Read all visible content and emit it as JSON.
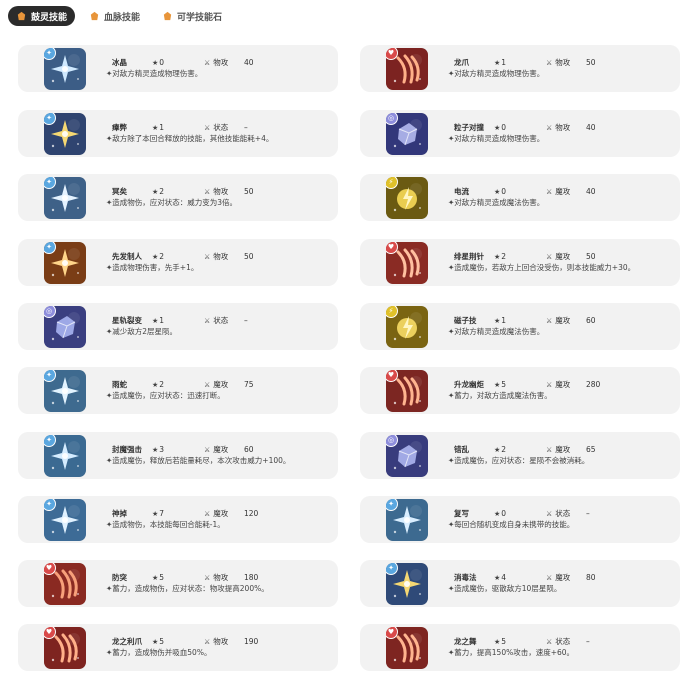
{
  "tabs": [
    {
      "label": "鼓灵技能",
      "active": true,
      "icon": "spirit-icon",
      "color": "#e8953a"
    },
    {
      "label": "血脉技能",
      "active": false,
      "icon": "bloodline-icon",
      "color": "#e8953a"
    },
    {
      "label": "可学技能石",
      "active": false,
      "icon": "skill-stone-icon",
      "color": "#e8953a"
    }
  ],
  "skills_left": [
    {
      "name": "冰晶",
      "cost": "0",
      "category": "物攻",
      "power": "40",
      "desc": "✦对敌方精灵造成物理伤害。",
      "element": "ice",
      "badge_color": "#5aa7e0",
      "art_bg": "#3c5d86",
      "art_fg": "#cfe9ff"
    },
    {
      "name": "瘴弊",
      "cost": "1",
      "category": "状态",
      "power": "–",
      "desc": "✦敌方除了本回合释放的技能，其他技能能耗+4。",
      "element": "ice",
      "badge_color": "#5aa7e0",
      "art_bg": "#2f4470",
      "art_fg": "#f5d873"
    },
    {
      "name": "冥矣",
      "cost": "2",
      "category": "物攻",
      "power": "50",
      "desc": "✦造成物伤，应对状态：威力变为3倍。",
      "element": "ice",
      "badge_color": "#5aa7e0",
      "art_bg": "#3e6188",
      "art_fg": "#e4f2ff"
    },
    {
      "name": "先发制人",
      "cost": "2",
      "category": "物攻",
      "power": "50",
      "desc": "✦造成物理伤害，先手+1。",
      "element": "ice",
      "badge_color": "#5aa7e0",
      "art_bg": "#7a3d16",
      "art_fg": "#ffd58a"
    },
    {
      "name": "星轨裂变",
      "cost": "1",
      "category": "状态",
      "power": "–",
      "desc": "✦减少敌方2层星陨。",
      "element": "spiral",
      "badge_color": "#8e8edc",
      "art_bg": "#3a3f80",
      "art_fg": "#b7c3ff"
    },
    {
      "name": "雨蛇",
      "cost": "2",
      "category": "魔攻",
      "power": "75",
      "desc": "✦造成魔伤，应对状态：迅速打断。",
      "element": "ice",
      "badge_color": "#5aa7e0",
      "art_bg": "#3e6a8f",
      "art_fg": "#e2f3ff"
    },
    {
      "name": "封魔强击",
      "cost": "3",
      "category": "魔攻",
      "power": "60",
      "desc": "✦造成魔伤，释放后若能量耗尽，本次攻击威力+100。",
      "element": "ice",
      "badge_color": "#5aa7e0",
      "art_bg": "#3b6a92",
      "art_fg": "#d4ecff"
    },
    {
      "name": "神掉",
      "cost": "7",
      "category": "魔攻",
      "power": "120",
      "desc": "✦造成物伤，本技能每回合能耗-1。",
      "element": "ice",
      "badge_color": "#5aa7e0",
      "art_bg": "#3d6b96",
      "art_fg": "#dff1ff"
    },
    {
      "name": "防突",
      "cost": "5",
      "category": "物攻",
      "power": "180",
      "desc": "✦蓄力，造成物伤，应对状态：物攻提高200%。",
      "element": "dragon",
      "badge_color": "#d94a4a",
      "art_bg": "#8a2a22",
      "art_fg": "#f7a07a"
    },
    {
      "name": "龙之利爪",
      "cost": "5",
      "category": "物攻",
      "power": "190",
      "desc": "✦蓄力，造成物伤并吸血50%。",
      "element": "dragon",
      "badge_color": "#d94a4a",
      "art_bg": "#7e2420",
      "art_fg": "#ffb089"
    }
  ],
  "skills_right": [
    {
      "name": "龙爪",
      "cost": "1",
      "category": "物攻",
      "power": "50",
      "desc": "✦对敌方精灵造成物理伤害。",
      "element": "dragon",
      "badge_color": "#d94a4a",
      "art_bg": "#7c2321",
      "art_fg": "#ffb089"
    },
    {
      "name": "粒子对撞",
      "cost": "0",
      "category": "物攻",
      "power": "40",
      "desc": "✦对敌方精灵造成物理伤害。",
      "element": "spiral",
      "badge_color": "#8e8edc",
      "art_bg": "#32377a",
      "art_fg": "#c3c9ff"
    },
    {
      "name": "电流",
      "cost": "0",
      "category": "魔攻",
      "power": "40",
      "desc": "✦对敌方精灵造成魔法伤害。",
      "element": "electric",
      "badge_color": "#e0c12a",
      "art_bg": "#6b5a12",
      "art_fg": "#ffe25c"
    },
    {
      "name": "绯星荆针",
      "cost": "2",
      "category": "魔攻",
      "power": "50",
      "desc": "✦造成魔伤，若敌方上回合没受伤，则本技能威力+30。",
      "element": "dragon",
      "badge_color": "#d94a4a",
      "art_bg": "#8a2b24",
      "art_fg": "#ffc0a0"
    },
    {
      "name": "磁子技",
      "cost": "1",
      "category": "魔攻",
      "power": "60",
      "desc": "✦对敌方精灵造成魔法伤害。",
      "element": "electric",
      "badge_color": "#e0c12a",
      "art_bg": "#7a6412",
      "art_fg": "#ffe36b"
    },
    {
      "name": "升龙幽炬",
      "cost": "5",
      "category": "魔攻",
      "power": "280",
      "desc": "✦蓄力，对敌方造成魔法伤害。",
      "element": "dragon",
      "badge_color": "#d94a4a",
      "art_bg": "#7c2622",
      "art_fg": "#ffb48f"
    },
    {
      "name": "错乱",
      "cost": "2",
      "category": "魔攻",
      "power": "65",
      "desc": "✦造成魔伤，应对状态：星陨不会被消耗。",
      "element": "spiral",
      "badge_color": "#8e8edc",
      "art_bg": "#383c7d",
      "art_fg": "#bcc4ff"
    },
    {
      "name": "复写",
      "cost": "0",
      "category": "状态",
      "power": "–",
      "desc": "✦每回合随机变成自身未携带的技能。",
      "element": "ice",
      "badge_color": "#5aa7e0",
      "art_bg": "#3d6a90",
      "art_fg": "#d9eeff"
    },
    {
      "name": "消毒法",
      "cost": "4",
      "category": "魔攻",
      "power": "80",
      "desc": "✦造成魔伤，驱散敌方10层星陨。",
      "element": "ice",
      "badge_color": "#5aa7e0",
      "art_bg": "#2f4a78",
      "art_fg": "#f5d873"
    },
    {
      "name": "龙之舞",
      "cost": "5",
      "category": "状态",
      "power": "–",
      "desc": "✦蓄力，提高150%攻击，速度+60。",
      "element": "dragon",
      "badge_color": "#d94a4a",
      "art_bg": "#7e2521",
      "art_fg": "#ffb48f"
    }
  ]
}
